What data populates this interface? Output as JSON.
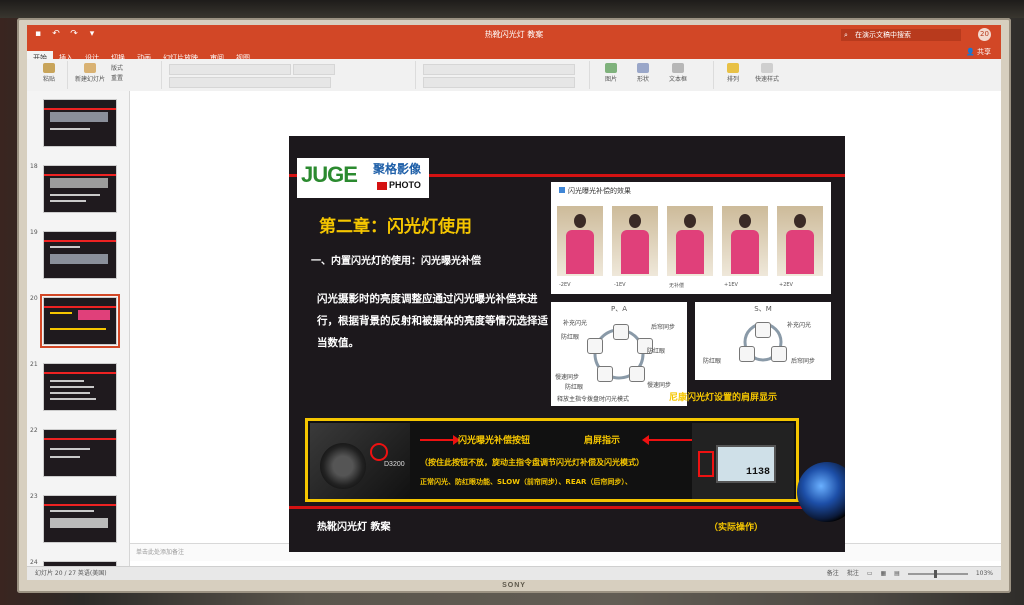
{
  "window": {
    "doc_title": "热靴闪光灯 教案",
    "search_placeholder": "在演示文稿中搜索",
    "avatar": "20",
    "share": "共享",
    "brand": "SONY"
  },
  "tabs": [
    "开始",
    "插入",
    "设计",
    "切换",
    "动画",
    "幻灯片放映",
    "审阅",
    "视图"
  ],
  "ribbon": {
    "paste": "粘贴",
    "new_slide": "新建幻灯片",
    "layout": "版式",
    "reset": "重置",
    "picture": "图片",
    "shape": "形状",
    "textbox": "文本框",
    "arrange": "排列",
    "quick_styles": "快速样式"
  },
  "thumbnails": [
    {
      "num": "",
      "sel": false
    },
    {
      "num": "18",
      "sel": false
    },
    {
      "num": "19",
      "sel": false
    },
    {
      "num": "20",
      "sel": true
    },
    {
      "num": "21",
      "sel": false
    },
    {
      "num": "22",
      "sel": false
    },
    {
      "num": "23",
      "sel": false
    },
    {
      "num": "24",
      "sel": false
    }
  ],
  "notes_placeholder": "单击此处添加备注",
  "status": {
    "left": "幻灯片 20 / 27    英语(美国)",
    "notes": "备注",
    "comments": "批注",
    "zoom": "103%"
  },
  "slide": {
    "logo_main": "JUGE",
    "logo_cn": "聚格影像",
    "logo_photo": "PHOTO",
    "chapter": "第二章：闪光灯使用",
    "subtitle": "一、内置闪光灯的使用：闪光曝光补偿",
    "body": "闪光摄影时的亮度调整应通过闪光曝光补偿来进行，根据背景的反射和被摄体的亮度等情况选择适当数值。",
    "photos_title": "闪光曝光补偿的效果",
    "ev_labels": [
      "-2EV",
      "-1EV",
      "无补偿",
      "+1EV",
      "+2EV"
    ],
    "diagram_left_title": "P、A",
    "diagram_left_nodes": [
      "补充闪光",
      "防红眼",
      "后帘同步",
      "慢速同步",
      "防红眼",
      "慢速同步",
      "防红眼"
    ],
    "diagram_left_footer": "释放主指令拨盘时闪光模式",
    "diagram_right_title": "S、M",
    "diagram_right_nodes": [
      "补充闪光",
      "防红眼",
      "后帘同步"
    ],
    "diagram_caption": "尼康闪光灯设置的肩屏显示",
    "box_label_1": "闪光曝光补偿按钮",
    "box_label_2": "肩屏指示",
    "box_line_1": "（按住此按钮不放，旋动主指令盘调节闪光灯补偿及闪光模式）",
    "box_line_2": "正常闪光、防红眼功能、SLOW（前帘同步）、REAR（后帘同步）、",
    "camera_model": "D3200",
    "lcd_value": "1138",
    "footer_left": "热靴闪光灯   教案",
    "footer_right": "（实际操作）"
  }
}
